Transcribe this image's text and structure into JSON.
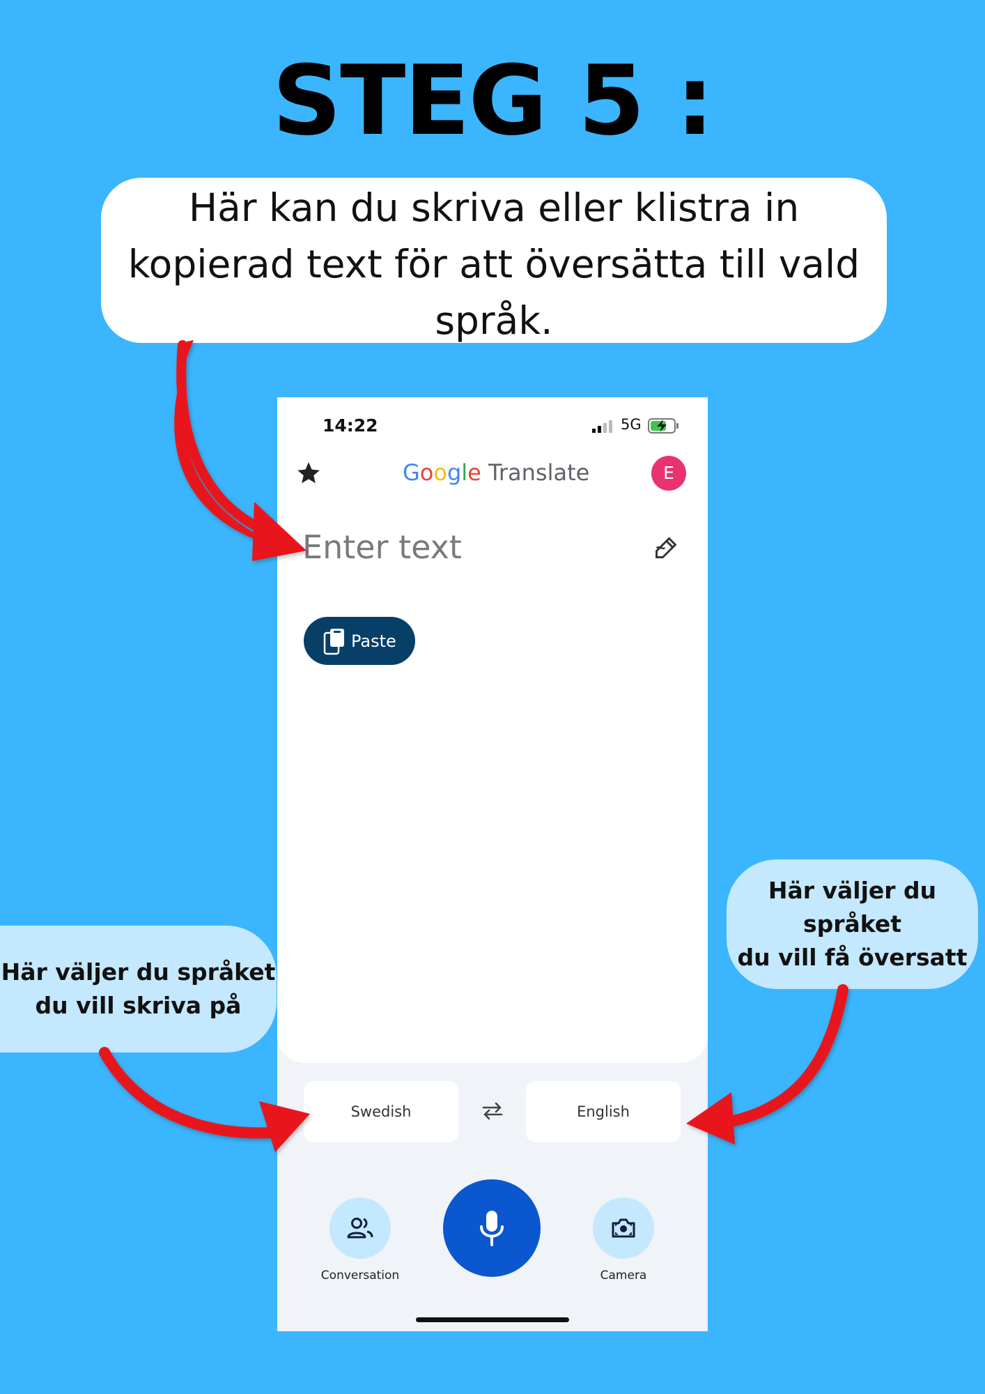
{
  "title": "STEG 5 :",
  "callouts": {
    "top_line1": "Här kan du skriva eller klistra in",
    "top_line2": "kopierad text för att översätta till vald",
    "top_line3": "språk.",
    "left_line1": "Här väljer du språket",
    "left_line2": "du vill skriva på",
    "right_line1": "Här väljer du språket",
    "right_line2": "du vill få översatt"
  },
  "phone": {
    "status": {
      "time": "14:22",
      "network": "5G"
    },
    "header": {
      "logo_google": [
        "G",
        "o",
        "o",
        "g",
        "l",
        "e"
      ],
      "logo_rest": "Translate",
      "avatar_letter": "E"
    },
    "input": {
      "placeholder": "Enter text",
      "value": ""
    },
    "paste_label": "Paste",
    "source_language": "Swedish",
    "target_language": "English",
    "conversation_label": "Conversation",
    "camera_label": "Camera"
  },
  "colors": {
    "background": "#3bb5fd",
    "callout_side": "#c4e8fd",
    "arrow": "#e8141f",
    "mic": "#0b57d0",
    "paste": "#083f69",
    "avatar": "#e8336f"
  },
  "icons": [
    "star-icon",
    "handwriting-icon",
    "paste-icon",
    "swap-icon",
    "microphone-icon",
    "people-icon",
    "camera-icon",
    "signal-icon",
    "battery-icon"
  ]
}
